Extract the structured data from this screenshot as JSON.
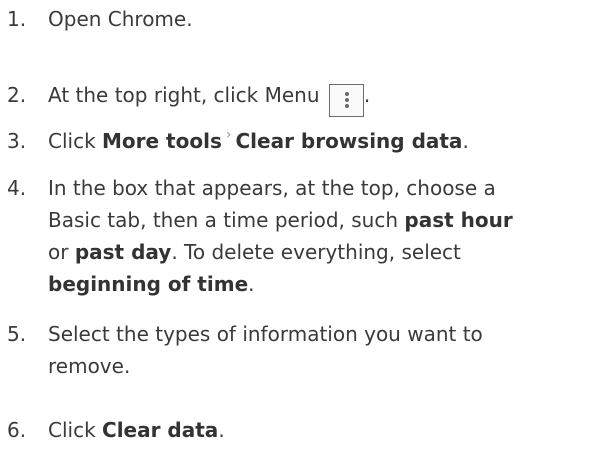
{
  "steps": [
    {
      "num": "1.",
      "lines": [
        "Open Chrome."
      ]
    },
    {
      "num": "2.",
      "pre": "At the top right, click Menu",
      "post": ".",
      "icon": "vertical-dots-menu-icon"
    },
    {
      "num": "3.",
      "pre": "Click ",
      "b1": "More tools",
      "sep": "›",
      "b2": "Clear browsing data",
      "post": "."
    },
    {
      "num": "4.",
      "l1": "In the box that appears, at the top, choose a",
      "l2a": "Basic tab, then a time period, such ",
      "l2b": "past hour",
      "l3a": "or ",
      "l3b": "past day",
      "l3c": ". To delete everything, select",
      "l4b": "beginning of time",
      "l4c": "."
    },
    {
      "num": "5.",
      "l1": "Select the types of information you want to",
      "l2": "remove."
    },
    {
      "num": "6.",
      "pre": "Click ",
      "b1": "Clear data",
      "post": "."
    }
  ]
}
